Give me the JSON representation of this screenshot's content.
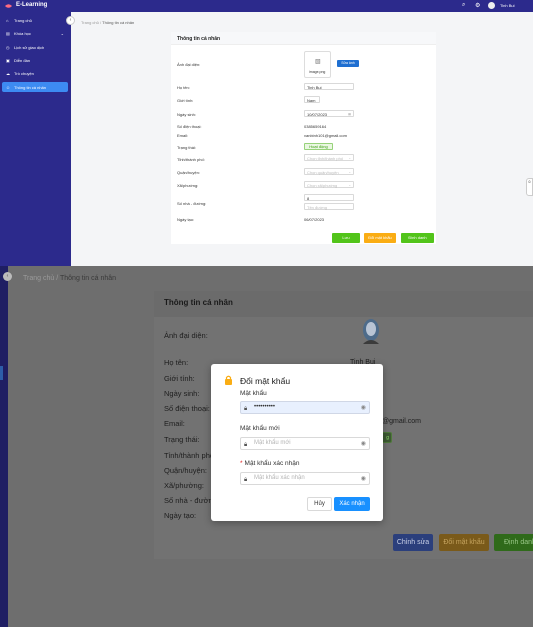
{
  "app": {
    "name": "E-Learning",
    "user_name": "Tinh Bui"
  },
  "sidebar": {
    "items": [
      {
        "label": "Trang chủ",
        "icon": "home-icon"
      },
      {
        "label": "Khóa học",
        "icon": "book-icon"
      },
      {
        "label": "Lịch sử giao dịch",
        "icon": "history-icon"
      },
      {
        "label": "Diễn đàn",
        "icon": "forum-icon"
      },
      {
        "label": "Trò chuyện",
        "icon": "chat-icon"
      },
      {
        "label": "Thông tin cá nhân",
        "icon": "user-icon",
        "active": true
      }
    ]
  },
  "breadcrumb": {
    "home": "Trang chủ",
    "separator": "/",
    "current": "Thông tin cá nhân"
  },
  "profile": {
    "title": "Thông tin cá nhân",
    "labels": {
      "avatar": "Ảnh đại diện:",
      "name": "Họ tên:",
      "gender": "Giới tính:",
      "dob": "Ngày sinh:",
      "phone": "Số điện thoại:",
      "email": "Email:",
      "status": "Trạng thái:",
      "province": "Tỉnh/thành phố:",
      "district": "Quận/huyện:",
      "ward": "Xã/phường:",
      "street": "Số nhà - đường:",
      "created": "Ngày tạo:"
    },
    "values": {
      "avatar_file": "image.png",
      "edit_avatar": "Sửa ảnh",
      "name": "Tinh Bui",
      "gender": "Nam",
      "dob": "10/07/2023",
      "phone": "0385659164",
      "email": "vanbinh101@gmail.com",
      "status": "Hoạt động",
      "province_placeholder": "Chọn tỉnh/thành phố",
      "district_placeholder": "Chọn quận/huyện",
      "ward_placeholder": "Chọn xã/phường",
      "street_number": "8",
      "street_placeholder": "Tên đường",
      "created": "06/07/2023"
    },
    "buttons": {
      "save": "Lưu",
      "change_password": "Đổi mật khẩu",
      "logout": "Đinh danh"
    }
  },
  "zoomed": {
    "name_partial": "Tinh Bui",
    "email_partial": "@gmail.com",
    "badge_partial": "g",
    "buttons": {
      "edit": "Chỉnh sửa",
      "change_password": "Đổi mật khẩu",
      "logout": "Định danh"
    }
  },
  "modal": {
    "title": "Đổi mật khẩu",
    "password_label": "Mật khẩu",
    "password_value": "••••••••••",
    "new_password_label": "Mật khẩu mới",
    "new_password_placeholder": "Mật khẩu mới",
    "confirm_label": "Mật khẩu xác nhận",
    "confirm_placeholder": "Mật khẩu xác nhận",
    "cancel": "Hủy",
    "confirm": "Xác nhận"
  },
  "colors": {
    "sidebar": "#2c2a8c",
    "active": "#3d8bf2",
    "primary": "#1890ff",
    "save": "#52c41a",
    "warning": "#faad14"
  }
}
